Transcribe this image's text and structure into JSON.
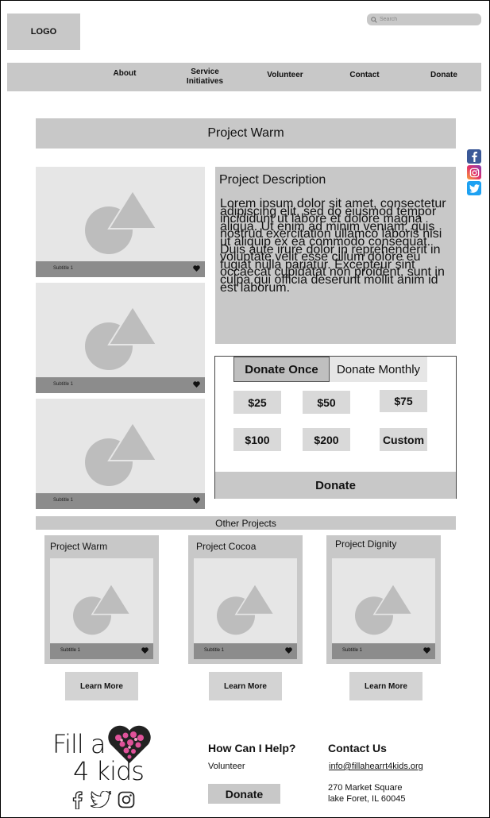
{
  "header": {
    "logo": "LOGO",
    "search_placeholder": "Search",
    "nav": [
      "About",
      "Service\nInitiatives",
      "Volunteer",
      "Contact",
      "Donate"
    ]
  },
  "page_title": "Project Warm",
  "social_icons": [
    "facebook-icon",
    "instagram-icon",
    "twitter-icon"
  ],
  "gallery": [
    {
      "subtitle": "Subtitle 1"
    },
    {
      "subtitle": "Subtitle 1"
    },
    {
      "subtitle": "Subtitle 1"
    }
  ],
  "description": {
    "heading": "Project Description",
    "body": "Lorem ipsum dolor sit amet, consectetur adipiscing elit, sed do eiusmod tempor incididunt ut labore et dolore magna aliqua. Ut enim ad minim veniam, quis nostrud exercitation ullamco laboris nisi ut aliquip ex ea commodo consequat. Duis aute irure dolor in reprehenderit in voluptate velit esse cillum dolore eu fugiat nulla pariatur. Excepteur sint occaecat cupidatat non proident, sunt in culpa qui officia deserunt mollit anim id est laborum."
  },
  "donate": {
    "tab_once": "Donate Once",
    "tab_monthly": "Donate Monthly",
    "amounts": [
      "$25",
      "$50",
      "$75",
      "$100",
      "$200",
      "Custom"
    ],
    "button": "Donate"
  },
  "other_projects": {
    "heading": "Other Projects",
    "items": [
      {
        "title": "Project Warm",
        "subtitle": "Subtitle 1",
        "button": "Learn More"
      },
      {
        "title": "Project Cocoa",
        "subtitle": "Subtitle 1",
        "button": "Learn More"
      },
      {
        "title": "Project Dignity",
        "subtitle": "Subtitle 1",
        "button": "Learn More"
      }
    ]
  },
  "footer": {
    "brand_line1": "Fill a",
    "brand_line2": "4 kids",
    "help_title": "How Can I Help?",
    "help_link": "Volunteer",
    "help_button": "Donate",
    "contact_title": "Contact Us",
    "email": "info@fillahearrt4kids.org",
    "address_line1": "270 Market Square",
    "address_line2": "lake Foret, IL 60045"
  }
}
